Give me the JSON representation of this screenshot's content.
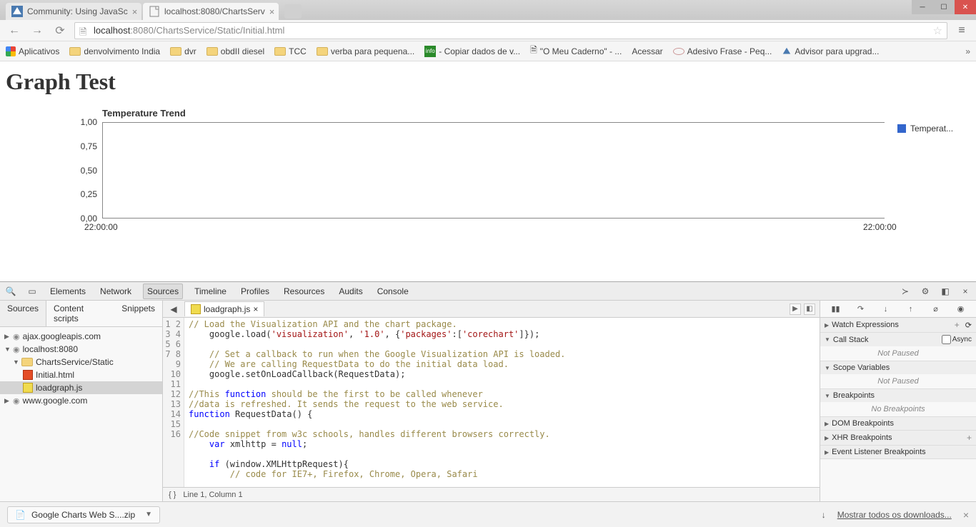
{
  "window": {
    "tabs": [
      {
        "title": "Community: Using JavaSc",
        "active": false
      },
      {
        "title": "localhost:8080/ChartsServ",
        "active": true
      }
    ]
  },
  "toolbar": {
    "url_host": "localhost",
    "url_port": ":8080",
    "url_path": "/ChartsService/Static/Initial.html"
  },
  "bookmarks": {
    "apps": "Aplicativos",
    "items": [
      "denvolvimento India",
      "dvr",
      "obdII diesel",
      "TCC",
      "verba para pequena..."
    ],
    "link_copy": "- Copiar dados de v...",
    "link_caderno": "\"O Meu Caderno\" - ...",
    "acessar": "Acessar",
    "adesivo": "Adesivo Frase - Peq...",
    "advisor": "Advisor para upgrad..."
  },
  "page": {
    "h1": "Graph Test",
    "chart_title": "Temperature Trend",
    "legend": "Temperat..."
  },
  "chart_data": {
    "type": "line",
    "title": "Temperature Trend",
    "xlabel": "",
    "ylabel": "",
    "ylim": [
      0,
      1
    ],
    "y_ticks": [
      "1,00",
      "0,75",
      "0,50",
      "0,25",
      "0,00"
    ],
    "x_ticks": [
      "22:00:00",
      "22:00:00"
    ],
    "series": [
      {
        "name": "Temperature",
        "values": []
      }
    ]
  },
  "devtools": {
    "tabs": [
      "Elements",
      "Network",
      "Sources",
      "Timeline",
      "Profiles",
      "Resources",
      "Audits",
      "Console"
    ],
    "active_tab": "Sources",
    "nav_tabs": [
      "Sources",
      "Content scripts",
      "Snippets"
    ],
    "tree": {
      "ajax": "ajax.googleapis.com",
      "localhost": "localhost:8080",
      "folder": "ChartsService/Static",
      "file_html": "Initial.html",
      "file_js": "loadgraph.js",
      "google": "www.google.com"
    },
    "editor_tab": "loadgraph.js",
    "status": "Line 1, Column 1",
    "code_lines": [
      "// Load the Visualization API and the chart package.",
      "    google.load('visualization', '1.0', {'packages':['corechart']});",
      "",
      "    // Set a callback to run when the Google Visualization API is loaded.",
      "    // We are calling RequestData to do the initial data load.",
      "    google.setOnLoadCallback(RequestData);",
      "",
      "//This function should be the first to be called whenever",
      "//data is refreshed. It sends the request to the web service.",
      "function RequestData() {",
      "",
      "//Code snippet from w3c schools, handles different browsers correctly.",
      "    var xmlhttp = null;",
      "",
      "    if (window.XMLHttpRequest){",
      "        // code for IE7+, Firefox, Chrome, Opera, Safari"
    ],
    "debug": {
      "watch": "Watch Expressions",
      "callstack": "Call Stack",
      "async": "Async",
      "not_paused": "Not Paused",
      "scope": "Scope Variables",
      "breakpoints": "Breakpoints",
      "no_breakpoints": "No Breakpoints",
      "dom_bp": "DOM Breakpoints",
      "xhr_bp": "XHR Breakpoints",
      "event_bp": "Event Listener Breakpoints"
    }
  },
  "downloads": {
    "item": "Google Charts Web S....zip",
    "show_all": "Mostrar todos os downloads..."
  }
}
